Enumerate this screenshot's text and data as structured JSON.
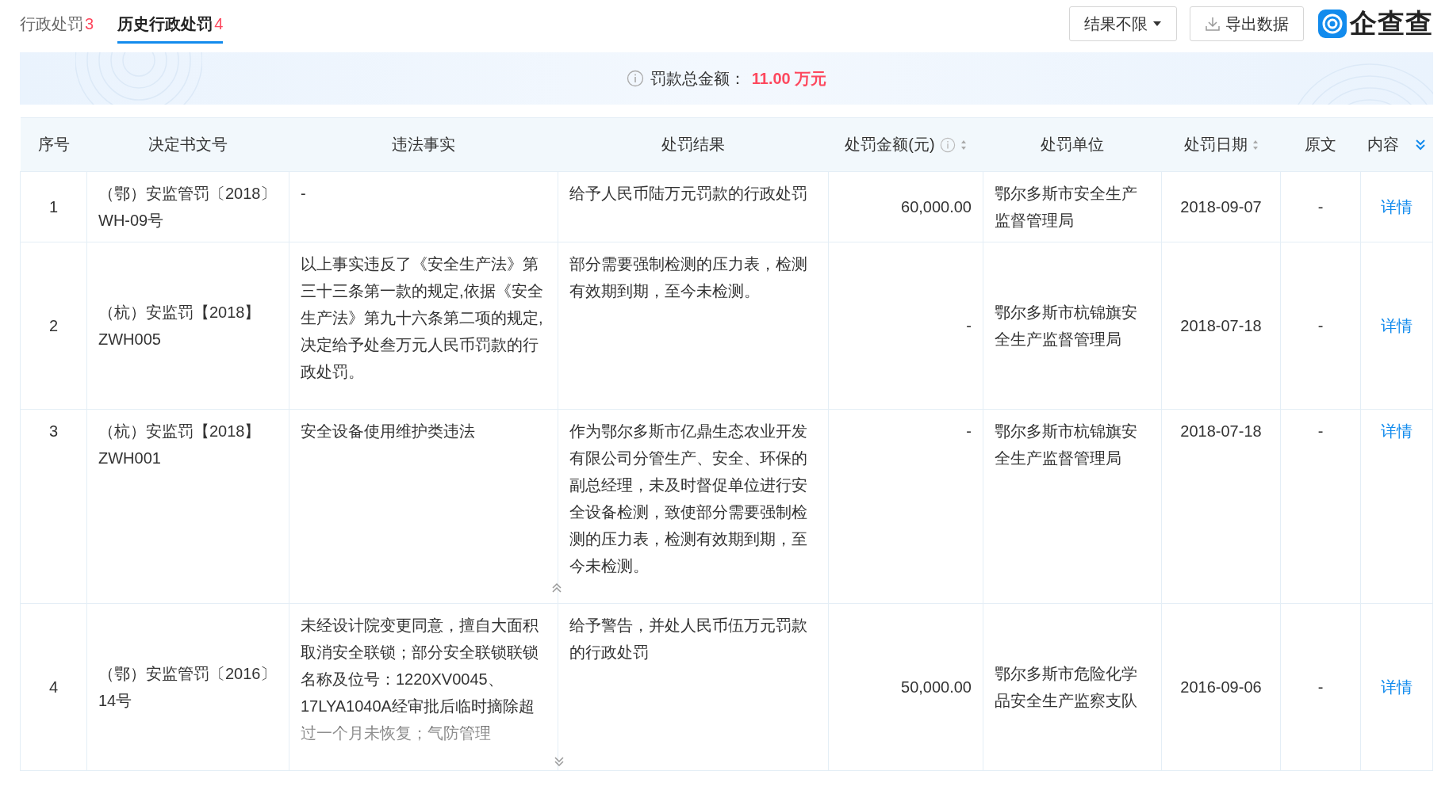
{
  "tabs": [
    {
      "label": "行政处罚",
      "count": "3",
      "selected": false
    },
    {
      "label": "历史行政处罚",
      "count": "4",
      "selected": true
    }
  ],
  "toolbar": {
    "filter": "结果不限",
    "export": "导出数据",
    "logo": "企查查"
  },
  "summary": {
    "label": "罚款总金额：",
    "value": "11.00 万元"
  },
  "table": {
    "columns": [
      {
        "label": "序号"
      },
      {
        "label": "决定书文号"
      },
      {
        "label": "违法事实"
      },
      {
        "label": "处罚结果"
      },
      {
        "label": "处罚金额(元)",
        "info": true,
        "sortable": true
      },
      {
        "label": "处罚单位"
      },
      {
        "label": "处罚日期",
        "sortable": true
      },
      {
        "label": "原文"
      },
      {
        "label": "内容",
        "expand": true
      }
    ],
    "rows": [
      {
        "index": "1",
        "doc_no": "（鄂）安监管罚〔2018〕WH-09号",
        "facts": "-",
        "result": "给予人民币陆万元罚款的行政处罚",
        "amount": "60,000.00",
        "authority": "鄂尔多斯市安全生产监督管理局",
        "date": "2018-09-07",
        "original": "-",
        "link": "详情",
        "result_expanded": false,
        "facts_truncated": false
      },
      {
        "index": "2",
        "doc_no": "（杭）安监罚【2018】ZWH005",
        "facts": "以上事实违反了《安全生产法》第三十三条第一款的规定,依据《安全生产法》第九十六条第二项的规定,决定给予处叁万元人民币罚款的行政处罚。",
        "result": "部分需要强制检测的压力表，检测有效期到期，至今未检测。",
        "amount": "-",
        "authority": "鄂尔多斯市杭锦旗安全生产监督管理局",
        "date": "2018-07-18",
        "original": "-",
        "link": "详情",
        "result_expanded": false,
        "facts_truncated": false
      },
      {
        "index": "3",
        "doc_no": "（杭）安监罚【2018】ZWH001",
        "facts": "安全设备使用维护类违法",
        "result": "作为鄂尔多斯市亿鼎生态农业开发有限公司分管生产、安全、环保的副总经理，未及时督促单位进行安全设备检测，致使部分需要强制检测的压力表，检测有效期到期，至今未检测。",
        "amount": "-",
        "authority": "鄂尔多斯市杭锦旗安全生产监督管理局",
        "date": "2018-07-18",
        "original": "-",
        "link": "详情",
        "result_expanded": true,
        "facts_truncated": false
      },
      {
        "index": "4",
        "doc_no": "（鄂）安监管罚〔2016〕14号",
        "facts": "未经设计院变更同意，擅自大面积取消安全联锁；部分安全联锁联锁名称及位号：1220XV0045、17LYA1040A经审批后临时摘除超过一个月未恢复；气防管理",
        "result": "给予警告，并处人民币伍万元罚款的行政处罚",
        "amount": "50,000.00",
        "authority": "鄂尔多斯市危险化学品安全生产监察支队",
        "date": "2016-09-06",
        "original": "-",
        "link": "详情",
        "result_expanded": false,
        "facts_truncated": true
      }
    ]
  }
}
